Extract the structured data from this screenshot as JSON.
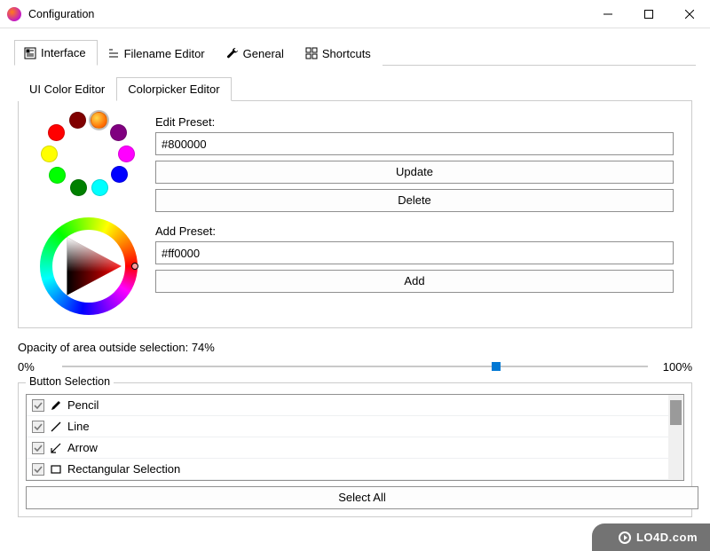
{
  "window": {
    "title": "Configuration"
  },
  "mainTabs": [
    {
      "label": "Interface"
    },
    {
      "label": "Filename Editor"
    },
    {
      "label": "General"
    },
    {
      "label": "Shortcuts"
    }
  ],
  "subTabs": [
    {
      "label": "UI Color Editor"
    },
    {
      "label": "Colorpicker Editor"
    }
  ],
  "editPreset": {
    "label": "Edit Preset:",
    "value": "#800000",
    "updateLabel": "Update",
    "deleteLabel": "Delete"
  },
  "swatches": [
    {
      "color": "#800000"
    },
    {
      "color": "#ff6600",
      "selected": true
    },
    {
      "color": "#800080"
    },
    {
      "color": "#ff0000"
    },
    {
      "color": "#ff00ff"
    },
    {
      "color": "#ffff00"
    },
    {
      "color": "#0000ff"
    },
    {
      "color": "#00ff00"
    },
    {
      "color": "#00ffff"
    },
    {
      "color": "#008000"
    }
  ],
  "addPreset": {
    "label": "Add Preset:",
    "value": "#ff0000",
    "addLabel": "Add"
  },
  "opacity": {
    "label": "Opacity of area outside selection: 74%",
    "min": "0%",
    "max": "100%",
    "value": 74
  },
  "buttonSelection": {
    "title": "Button Selection",
    "items": [
      {
        "label": "Pencil"
      },
      {
        "label": "Line"
      },
      {
        "label": "Arrow"
      },
      {
        "label": "Rectangular Selection"
      }
    ],
    "selectAllLabel": "Select All"
  },
  "watermark": {
    "text": "LO4D.com"
  }
}
